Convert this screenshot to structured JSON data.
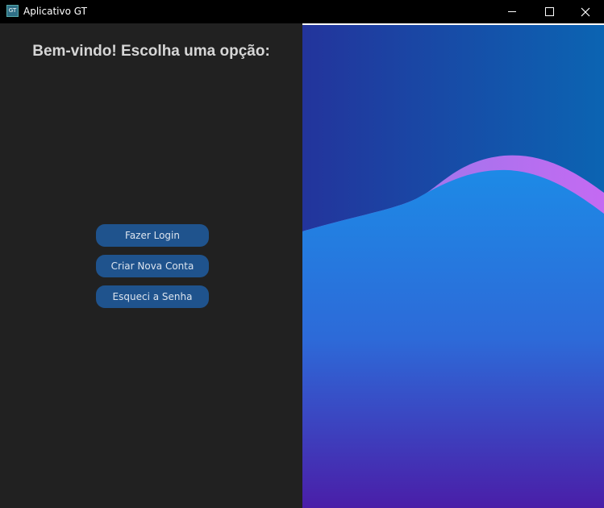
{
  "window": {
    "title": "Aplicativo GT",
    "icon_text": "GT"
  },
  "controls": {
    "minimize": "minimize-icon",
    "maximize": "maximize-icon",
    "close": "close-icon"
  },
  "left": {
    "heading": "Bem-vindo! Escolha uma opção:",
    "buttons": [
      {
        "label": "Fazer Login"
      },
      {
        "label": "Criar Nova Conta"
      },
      {
        "label": "Esqueci a Senha"
      }
    ]
  },
  "colors": {
    "panel_bg": "#212121",
    "button_bg": "#1f538d",
    "wave_top": "#2a3fa8",
    "wave_bottom": "#4a1ea8",
    "wave_accent": "#b66ef0"
  }
}
